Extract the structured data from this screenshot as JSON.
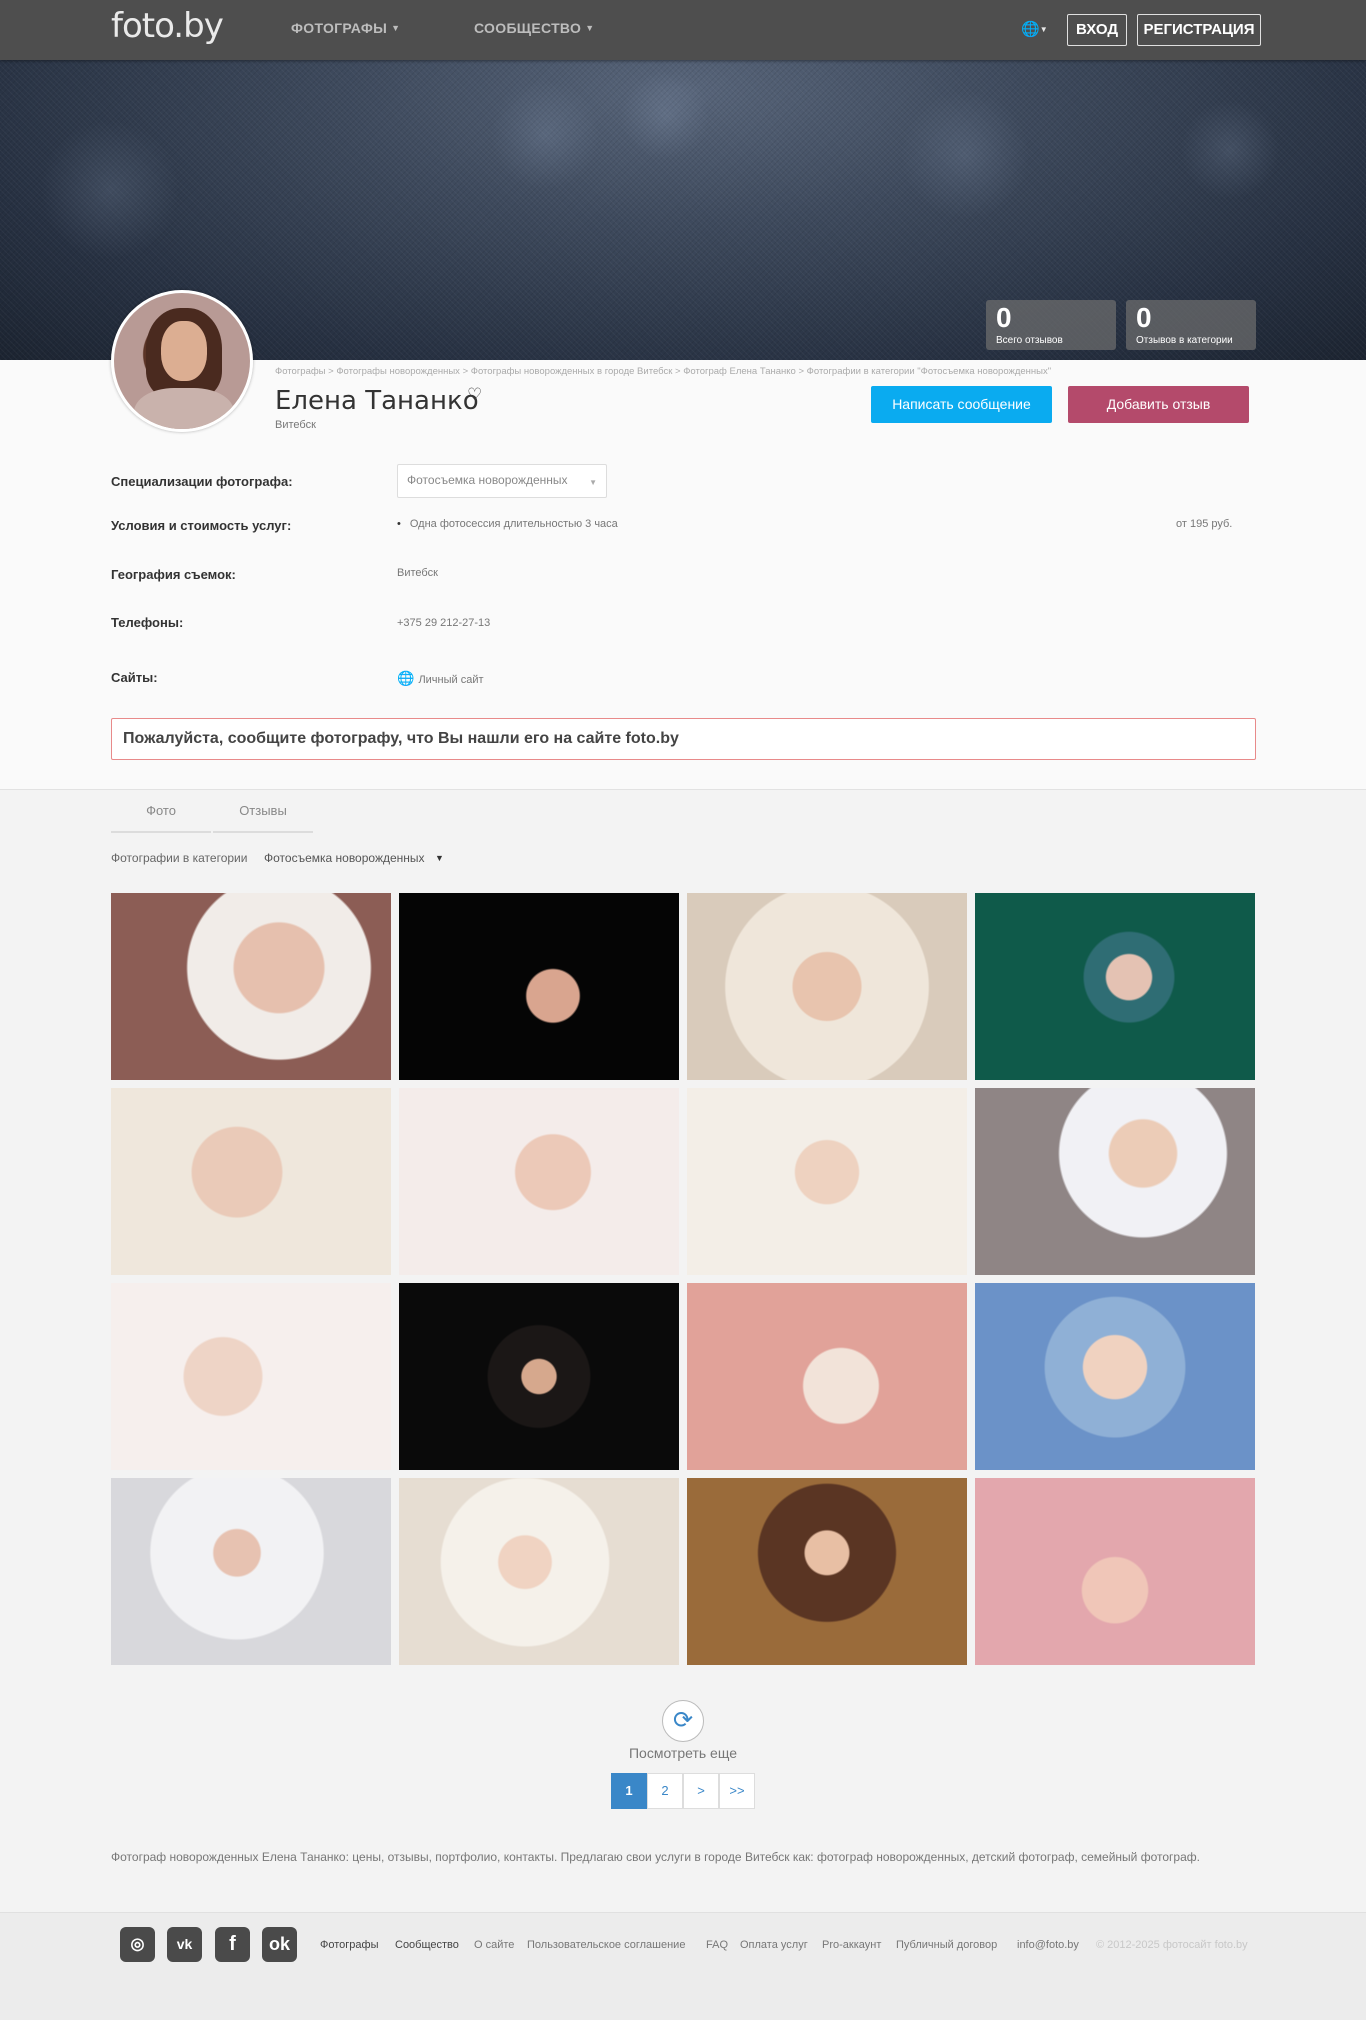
{
  "nav": {
    "logo": "foto.by",
    "photographers": "ФОТОГРАФЫ",
    "community": "СООБЩЕСТВО",
    "login": "ВХОД",
    "register": "РЕГИСТРАЦИЯ"
  },
  "stats": [
    {
      "num": "0",
      "label": "Всего отзывов"
    },
    {
      "num": "0",
      "label": "Отзывов в категории"
    }
  ],
  "breadcrumb": "Фотографы > Фотографы новорожденных > Фотографы новорожденных в городе Витебск > Фотограф Елена Тананко > Фотографии в категории \"Фотосъемка новорожденных\"",
  "profile": {
    "name": "Елена Тананко",
    "city": "Витебск",
    "message_button": "Написать сообщение",
    "review_button": "Добавить отзыв"
  },
  "details": {
    "spec_label": "Специализации фотографа:",
    "spec_value": "Фотосъемка новорожденных",
    "terms_label": "Условия и стоимость услуг:",
    "terms_item": "Одна фотосессия длительностью 3 часа",
    "terms_price": "от 195 руб.",
    "geo_label": "География съемок:",
    "geo_value": "Витебск",
    "phones_label": "Телефоны:",
    "phones_value": "+375 29 212-27-13",
    "sites_label": "Сайты:",
    "sites_value": "Личный сайт"
  },
  "notice": "Пожалуйста, сообщите фотографу, что Вы нашли его на сайте foto.by",
  "tabs": {
    "photos": "Фото",
    "reviews": "Отзывы"
  },
  "filter": {
    "label": "Фотографии в категории",
    "value": "Фотосъемка новорожденных"
  },
  "more": {
    "label": "Посмотреть еще"
  },
  "pagination": [
    "1",
    "2",
    ">",
    ">>"
  ],
  "seo_text": "Фотограф новорожденных Елена Тананко: цены, отзывы, портфолио, контакты. Предлагаю свои услуги в городе Витебск как: фотограф новорожденных, детский фотограф, семейный фотограф.",
  "footer": {
    "social": [
      "instagram-icon",
      "vk-icon",
      "facebook-icon",
      "odnoklassniki-icon"
    ],
    "links": [
      "Фотографы",
      "Сообщество",
      "О сайте",
      "Пользовательское соглашение",
      "FAQ",
      "Оплата услуг",
      "Pro-аккаунт",
      "Публичный договор",
      "info@foto.by"
    ],
    "copyright": "© 2012-2025 фотосайт foto.by"
  },
  "colors": {
    "navbar": "#4e4e4e",
    "message_button": "#0aabf0",
    "review_button": "#b44a6b",
    "active_page": "#3a87c8",
    "notice_border": "#e88a8a"
  }
}
